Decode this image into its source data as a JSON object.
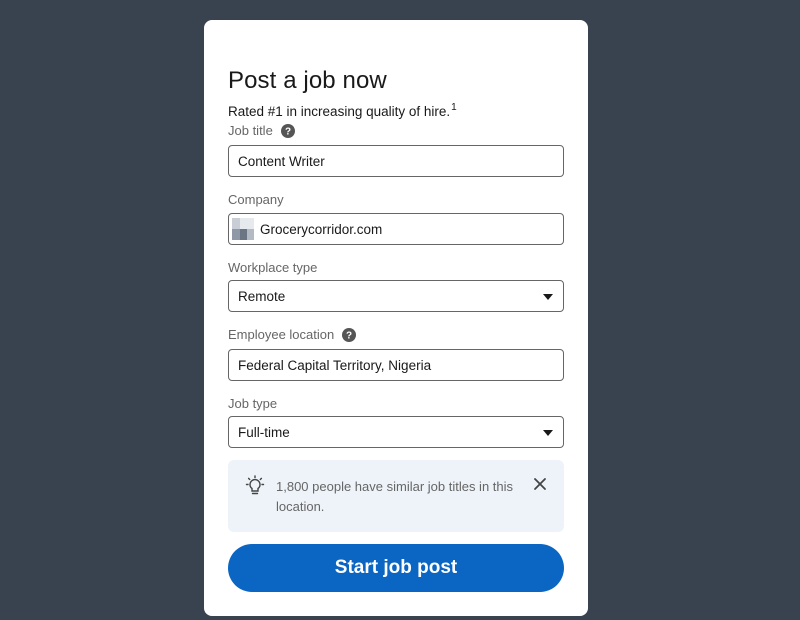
{
  "card": {
    "title": "Post a job now",
    "subtitle": "Rated #1 in increasing quality of hire.",
    "subtitle_footnote": "1"
  },
  "fields": {
    "job_title": {
      "label": "Job title",
      "value": "Content Writer",
      "help_icon": "question-circle-icon"
    },
    "company": {
      "label": "Company",
      "value": "Grocerycorridor.com",
      "logo_icon": "company-logo-icon"
    },
    "workplace_type": {
      "label": "Workplace type",
      "value": "Remote",
      "caret_icon": "caret-down-icon"
    },
    "employee_location": {
      "label": "Employee location",
      "value": "Federal Capital Territory, Nigeria",
      "help_icon": "question-circle-icon"
    },
    "job_type": {
      "label": "Job type",
      "value": "Full-time",
      "caret_icon": "caret-down-icon"
    }
  },
  "insight": {
    "icon": "lightbulb-icon",
    "text": "1,800 people have similar job titles in this location.",
    "close_icon": "close-icon"
  },
  "actions": {
    "start_label": "Start job post"
  },
  "colors": {
    "backdrop": "#38434f",
    "primary": "#0a66c2",
    "insight_bg": "#edf3f8"
  }
}
